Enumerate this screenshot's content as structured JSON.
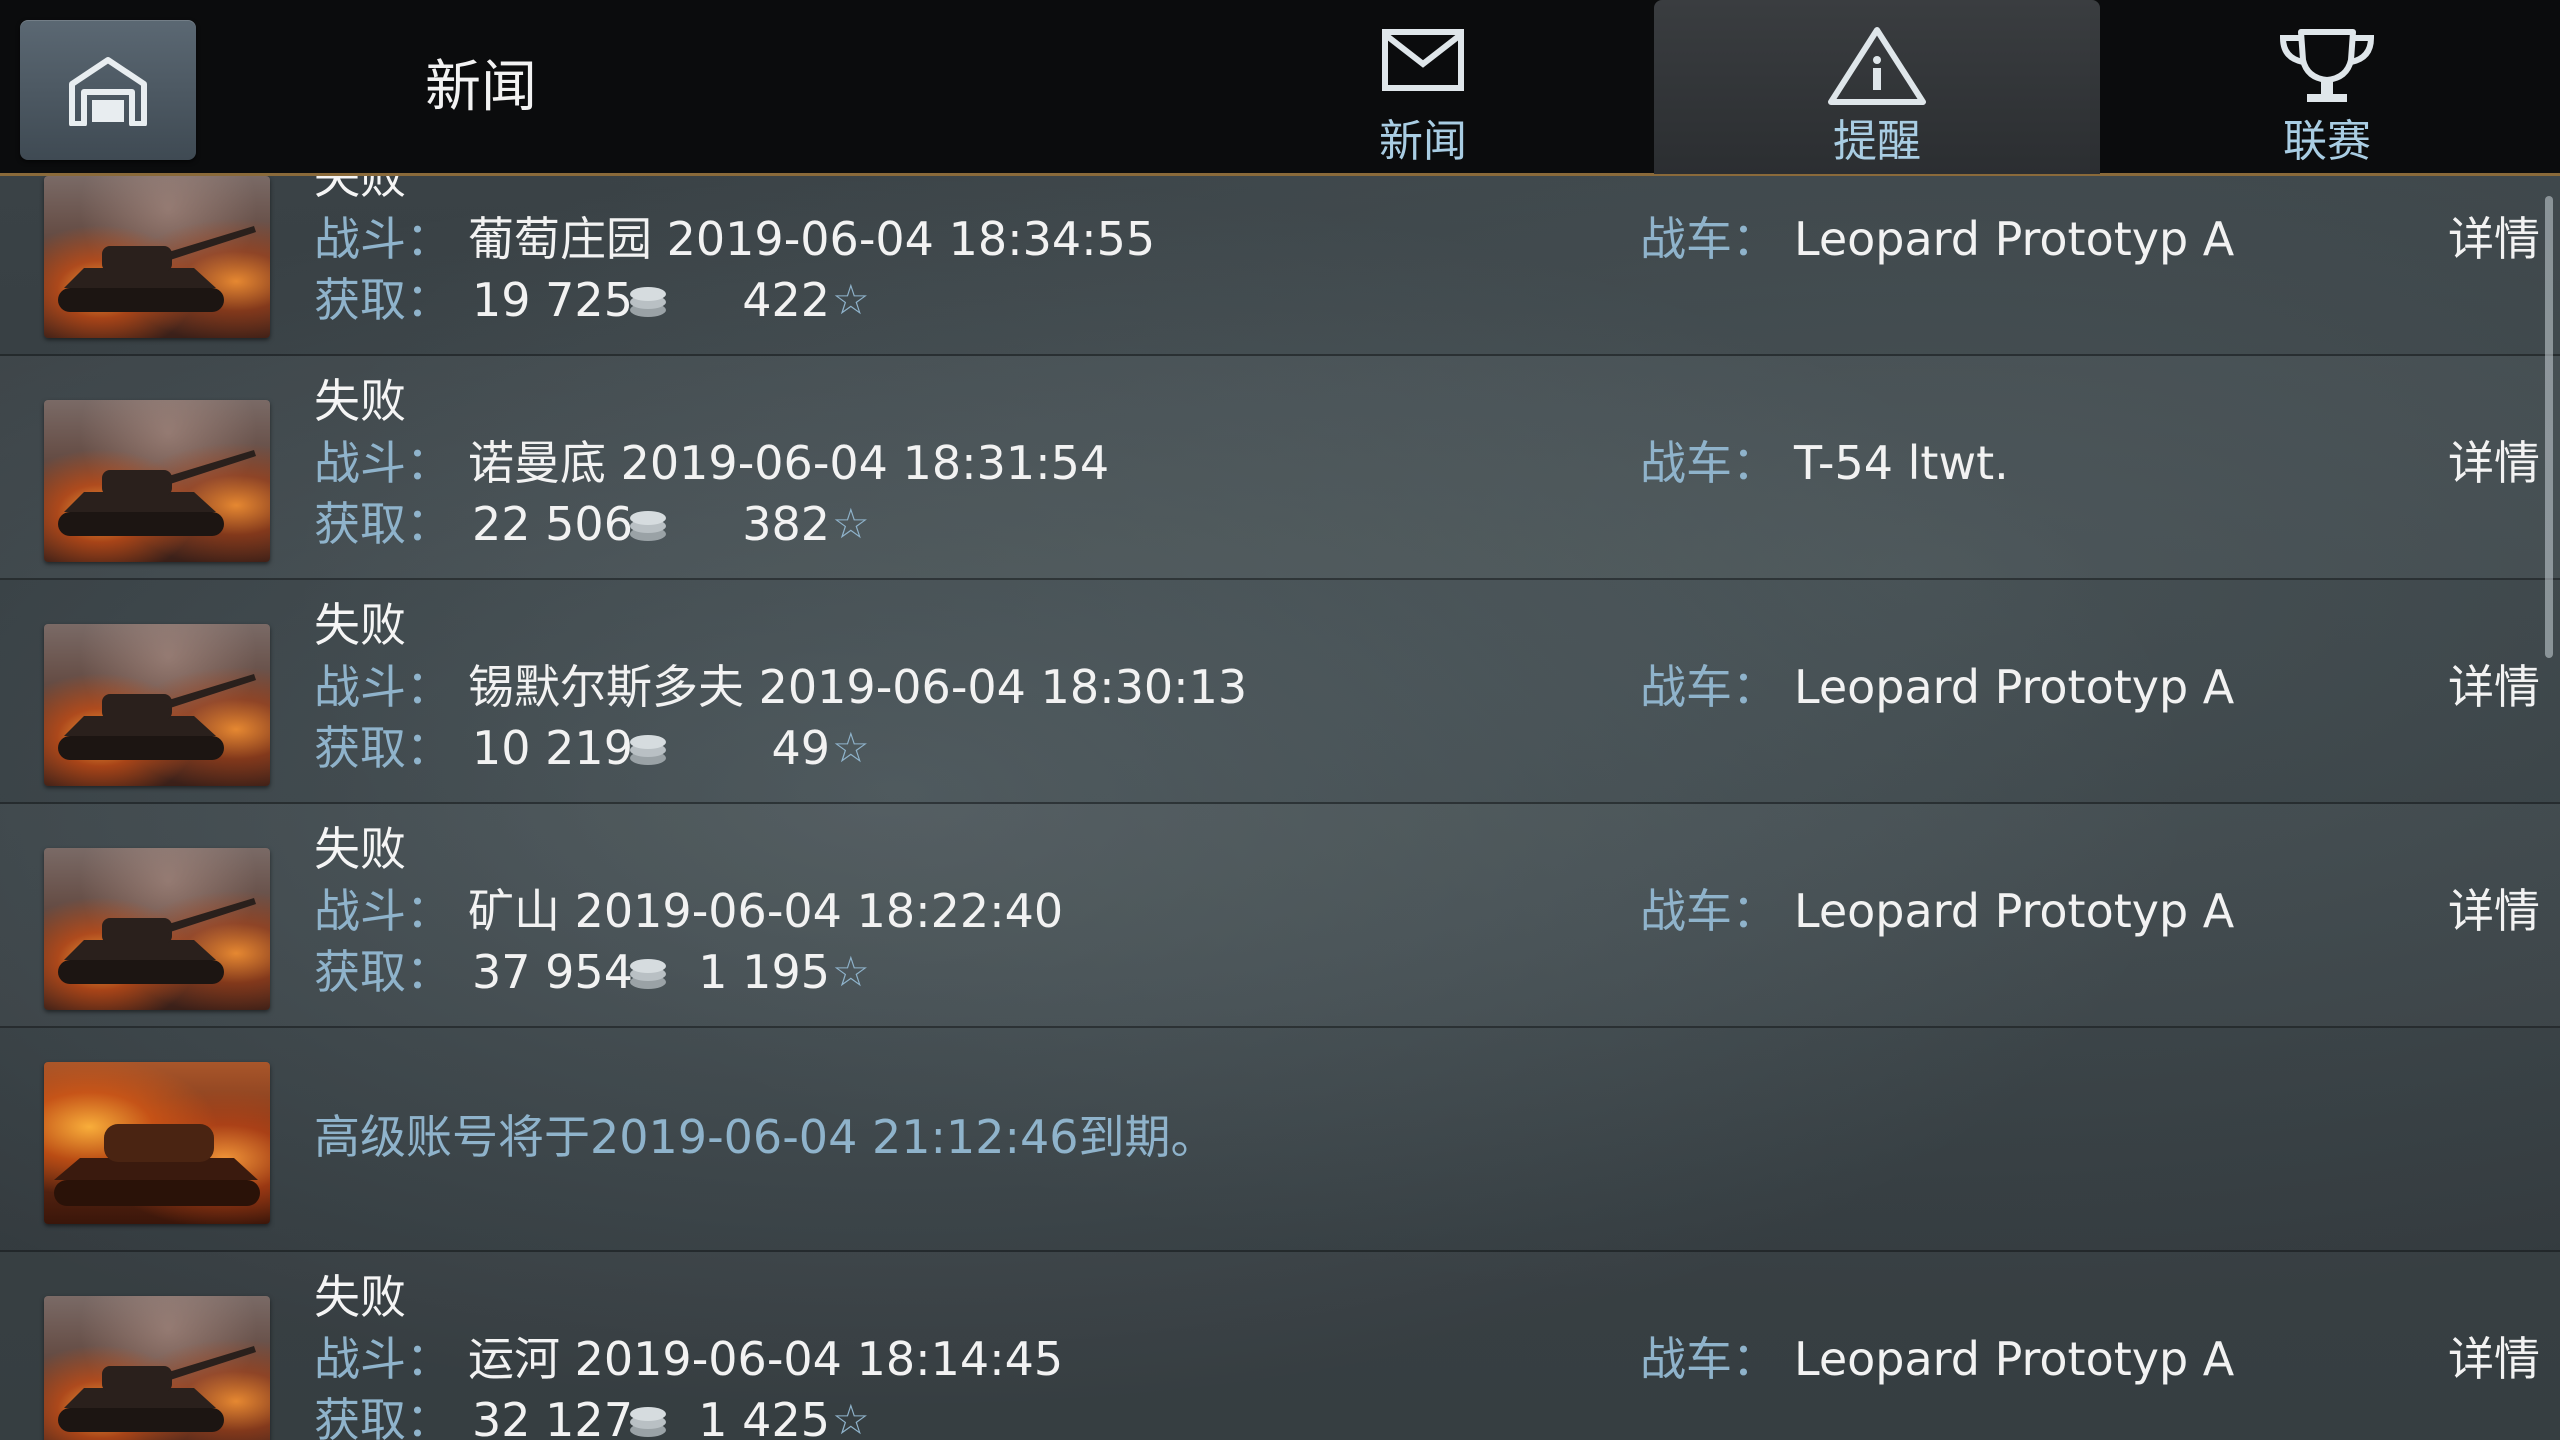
{
  "header": {
    "title": "新闻",
    "tabs": [
      {
        "label": "新闻",
        "icon": "mail-icon",
        "active": false
      },
      {
        "label": "提醒",
        "icon": "warning-icon",
        "active": true
      },
      {
        "label": "联赛",
        "icon": "trophy-icon",
        "active": false
      }
    ],
    "accent_color": "#8a6a3a"
  },
  "labels": {
    "battle": "战斗：",
    "earned": "获取：",
    "vehicle": "战车：",
    "details": "详情"
  },
  "colors": {
    "label_blue": "#8fb3cb",
    "text_white": "#f2f2f2"
  },
  "feed": [
    {
      "type": "battle",
      "result": "失败",
      "battle": "葡萄庄园 2019-06-04 18:34:55",
      "credits": "19 725",
      "xp": "422",
      "vehicle": "Leopard Prototyp A"
    },
    {
      "type": "battle",
      "result": "失败",
      "battle": "诺曼底 2019-06-04 18:31:54",
      "credits": "22 506",
      "xp": "382",
      "vehicle": "T-54 ltwt."
    },
    {
      "type": "battle",
      "result": "失败",
      "battle": "锡默尔斯多夫 2019-06-04 18:30:13",
      "credits": "10 219",
      "xp": "49",
      "vehicle": "Leopard Prototyp A"
    },
    {
      "type": "battle",
      "result": "失败",
      "battle": "矿山 2019-06-04 18:22:40",
      "credits": "37 954",
      "xp": "1 195",
      "vehicle": "Leopard Prototyp A"
    },
    {
      "type": "notice",
      "text": "高级账号将于2019-06-04 21:12:46到期。"
    },
    {
      "type": "battle",
      "result": "失败",
      "battle": "运河 2019-06-04 18:14:45",
      "credits": "32 127",
      "xp": "1 425",
      "vehicle": "Leopard Prototyp A"
    }
  ]
}
